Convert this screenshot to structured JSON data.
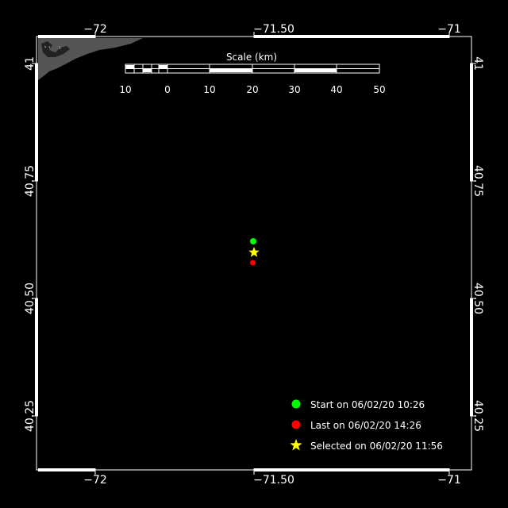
{
  "map": {
    "x_ticks": [
      "−72",
      "−71.50",
      "−71"
    ],
    "y_ticks": [
      "41",
      "40.75",
      "40.50",
      "40.25"
    ],
    "scale": {
      "title": "Scale (km)",
      "labels": [
        "10",
        "0",
        "10",
        "20",
        "30",
        "40",
        "50"
      ]
    },
    "land_color": "#555555",
    "frame_color": "#ffffff"
  },
  "track": {
    "start_color": "#00ff00",
    "last_color": "#ff0000",
    "selected_color": "#ffff00"
  },
  "legend": {
    "items": [
      {
        "label": "Start on 06/02/20 10:26",
        "symbol": "green-dot-icon"
      },
      {
        "label": "Last on 06/02/20 14:26",
        "symbol": "red-dot-icon"
      },
      {
        "label": "Selected on 06/02/20 11:56",
        "symbol": "yellow-star-icon"
      }
    ]
  }
}
